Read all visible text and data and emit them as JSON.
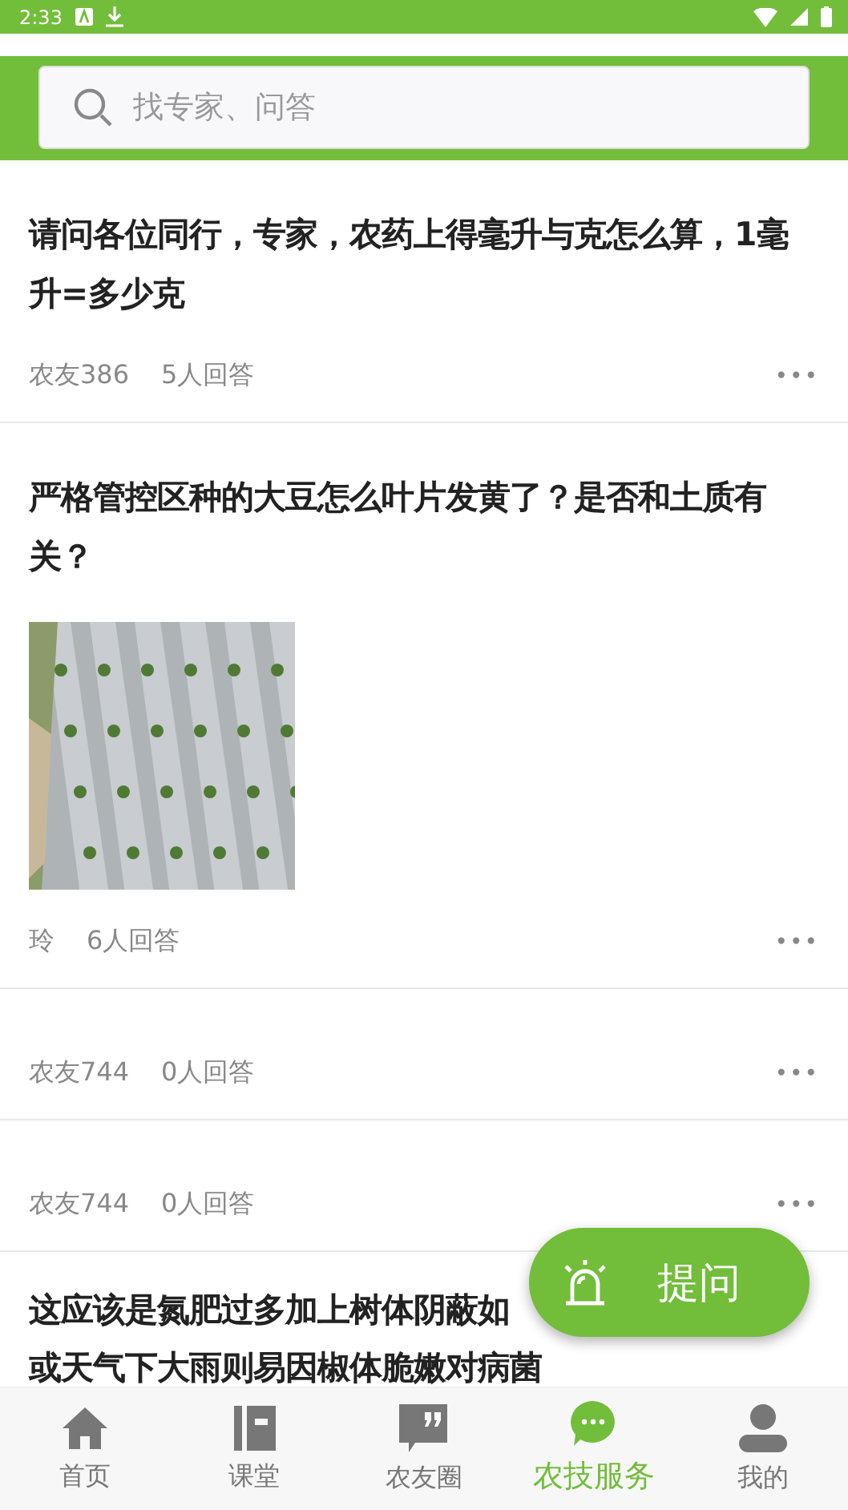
{
  "status_bar": {
    "time": "2:33"
  },
  "search": {
    "placeholder": "找专家、问答"
  },
  "questions": [
    {
      "title_lines": [
        "请问各位同行，专家，农药上得毫升与克怎么算，1毫升=多少克"
      ],
      "kind": "text",
      "author": "农友386",
      "answers": "5人回答",
      "more": "•••"
    },
    {
      "title_lines": [
        "严格管控区种的大豆怎么叶片发黄了？是否和土质有关？"
      ],
      "kind": "picture",
      "author": "玲",
      "answers": "6人回答",
      "more": "•••"
    },
    {
      "kind": "text",
      "author": "农友744",
      "answers": "0人回答",
      "more": "•••"
    },
    {
      "kind": "text",
      "author": "农友744",
      "answers": "0人回答",
      "more": "•••"
    },
    {
      "title_lines": [
        "这应该是氮肥过多加上树体阴蔽如",
        "或天气下大雨则易因椒体脆嫩对病菌"
      ],
      "kind": "partial"
    }
  ],
  "ask_button": {
    "label": "提问"
  },
  "tabs": [
    {
      "label": "首页",
      "kind": "home",
      "selected": false
    },
    {
      "label": "课堂",
      "kind": "book",
      "selected": false
    },
    {
      "label": "农友圈",
      "kind": "quote",
      "selected": false
    },
    {
      "label": "农技服务",
      "kind": "chat",
      "selected": true
    },
    {
      "label": "我的",
      "kind": "person",
      "selected": false
    }
  ]
}
